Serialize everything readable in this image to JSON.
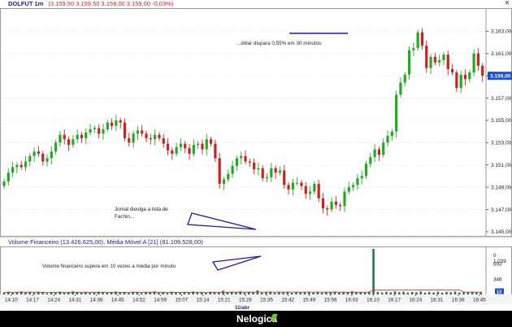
{
  "window": {
    "title": "DOLFUT 1m",
    "quote": "(3.159,50  3.159,50  3.159,00  3.159,00  -0,03%)"
  },
  "volume_panel": {
    "title": "Volume Financeiro (13.426.625,00), Média Móvel A [21] (81.109.528,00)"
  },
  "annotations": {
    "dollar_spike": "...dólar dispara 0,55% em 30 minutos",
    "jornal_line1": "Jornal divulga a lista de",
    "jornal_line2": "Fachin...",
    "volume_note": "Volume financeiro supera em 10 vezes a média por minuto"
  },
  "footer": {
    "brand": "Nelogica"
  },
  "colors": {
    "up": "#22aa22",
    "down": "#cc2222",
    "annotation": "#1a1aaa",
    "last_price_bg": "#1a4fc8",
    "footer_bg": "#000000"
  },
  "chart_data": [
    {
      "type": "candlestick",
      "title": "DOLFUT 1m",
      "date_label": "11/abr",
      "x_ticks": [
        "14:10",
        "14:17",
        "14:24",
        "14:31",
        "14:38",
        "14:45",
        "14:52",
        "14:59",
        "15:07",
        "15:14",
        "15:21",
        "15:28",
        "15:35",
        "15:42",
        "15:49",
        "15:56",
        "16:03",
        "16:10",
        "16:17",
        "16:24",
        "16:31",
        "16:38",
        "16:45"
      ],
      "y_ticks": [
        3145.0,
        3147.0,
        3149.0,
        3151.0,
        3153.0,
        3155.0,
        3157.0,
        3159.0,
        3161.0,
        3163.0
      ],
      "y_tick_labels": [
        "3.145,00",
        "3.147,00",
        "3.149,00",
        "3.151,00",
        "3.153,00",
        "3.155,00",
        "3.157,00",
        "3.159,00",
        "3.161,00",
        "3.163,00"
      ],
      "ylim": [
        3144.7,
        3165.0
      ],
      "last_price": 3159.0,
      "last_price_label": "3.159,00",
      "close": [
        3149.5,
        3150.3,
        3150.8,
        3151.0,
        3150.8,
        3151.3,
        3151.8,
        3152.2,
        3152.0,
        3151.3,
        3151.6,
        3152.2,
        3153.0,
        3153.7,
        3153.3,
        3152.8,
        3153.3,
        3153.7,
        3153.4,
        3153.9,
        3154.2,
        3154.3,
        3153.8,
        3154.2,
        3154.8,
        3154.5,
        3155.0,
        3154.8,
        3153.4,
        3153.0,
        3153.8,
        3154.1,
        3153.8,
        3153.4,
        3153.3,
        3153.7,
        3153.4,
        3152.9,
        3152.3,
        3152.0,
        3152.6,
        3152.9,
        3152.5,
        3152.0,
        3152.8,
        3152.9,
        3152.4,
        3153.3,
        3152.9,
        3151.6,
        3149.3,
        3149.7,
        3150.2,
        3150.9,
        3151.6,
        3151.8,
        3151.3,
        3151.2,
        3150.6,
        3150.7,
        3149.8,
        3149.9,
        3150.7,
        3150.3,
        3150.5,
        3149.2,
        3148.8,
        3149.4,
        3149.4,
        3149.1,
        3148.4,
        3148.6,
        3149.3,
        3148.0,
        3147.1,
        3147.0,
        3147.7,
        3147.4,
        3147.3,
        3148.6,
        3149.0,
        3149.2,
        3149.8,
        3150.0,
        3151.1,
        3151.7,
        3152.4,
        3151.9,
        3153.0,
        3153.6,
        3154.0,
        3157.3,
        3158.4,
        3159.1,
        3161.3,
        3161.5,
        3162.9,
        3161.7,
        3159.7,
        3160.7,
        3160.2,
        3160.4,
        3160.9,
        3159.6,
        3159.3,
        3157.9,
        3159.1,
        3158.7,
        3159.3,
        3161.0,
        3159.9,
        3159.0
      ]
    },
    {
      "type": "bar",
      "title": "Volume Financeiro",
      "series_labels": [
        "Volume Financeiro",
        "Média Móvel A [21]"
      ],
      "y_tick_labels": [
        "0",
        "1.039",
        "693",
        "346",
        "13"
      ],
      "ylim": [
        0,
        1039
      ],
      "spike_index": 86,
      "spike_value": 1039,
      "values": [
        45,
        60,
        38,
        55,
        70,
        42,
        50,
        35,
        62,
        48,
        30,
        55,
        40,
        65,
        38,
        45,
        72,
        50,
        41,
        58,
        36,
        44,
        61,
        52,
        39,
        48,
        66,
        43,
        55,
        37,
        64,
        49,
        33,
        57,
        46,
        70,
        40,
        52,
        35,
        61,
        44,
        38,
        56,
        47,
        68,
        42,
        53,
        36,
        60,
        45,
        41,
        88,
        50,
        62,
        44,
        71,
        39,
        58,
        48,
        95,
        43,
        52,
        67,
        40,
        56,
        46,
        63,
        38,
        51,
        45,
        49,
        57,
        42,
        60,
        36,
        54,
        48,
        66,
        41,
        59,
        44,
        72,
        47,
        53,
        39,
        62,
        1039,
        58,
        45,
        61,
        48,
        70,
        52,
        64,
        44,
        57,
        49,
        68,
        43,
        55,
        46,
        63,
        41,
        59,
        50,
        67,
        45,
        53,
        48,
        62,
        44,
        58
      ]
    }
  ]
}
